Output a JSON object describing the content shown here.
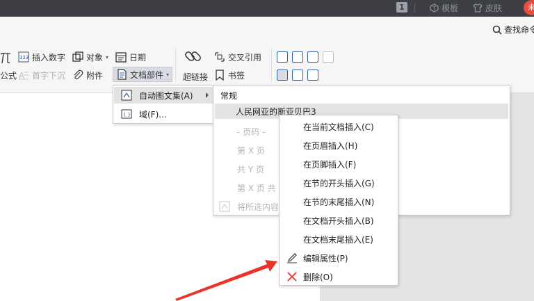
{
  "titlebar": {
    "badge": "1",
    "template_label": "模板",
    "skin_label": "皮肤",
    "avatar_char": "未"
  },
  "ribbon": {
    "search_cmd": "查找命令",
    "formula_label": "公式",
    "insert_number": "插入数字",
    "drop_cap": "首字下沉",
    "object": "对象",
    "attachment": "附件",
    "date": "日期",
    "doc_parts": "文档部件",
    "hyperlink": "超链接",
    "cross_ref": "交叉引用",
    "bookmark": "书签"
  },
  "parts_menu": {
    "items": [
      "自动图文集(A)",
      "域(F)..."
    ]
  },
  "autotext_menu": {
    "header": "常规",
    "entry": "人民网亚的斯亚贝巴3",
    "disabled_items": [
      "- 页码 -",
      "第 X 页",
      "共 Y 页",
      "第 X 页 共",
      "将所选内容"
    ]
  },
  "entry_menu": {
    "items": [
      "在当前文档插入(C)",
      "在页眉插入(H)",
      "在页脚插入(F)",
      "在节的开头插入(G)",
      "在节的末尾插入(N)",
      "在文档开头插入(B)",
      "在文档末尾插入(E)",
      "编辑属性(P)",
      "删除(O)"
    ]
  },
  "colors": {
    "accent_blue": "#2a5fa8",
    "arrow_red": "#e8342a",
    "delete_red": "#e84c3d"
  }
}
